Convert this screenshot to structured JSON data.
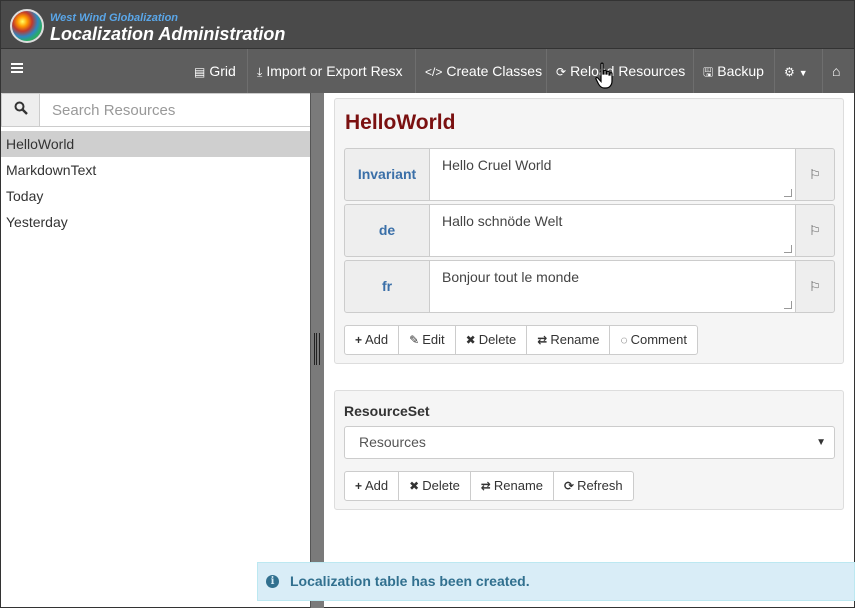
{
  "header": {
    "subtitle": "West Wind Globalization",
    "title": "Localization Administration"
  },
  "toolbar": {
    "items": [
      {
        "label": "Grid",
        "icon": "grid-icon"
      },
      {
        "label": "Import or Export Resx",
        "icon": "download-icon"
      },
      {
        "label": "Create Classes",
        "icon": "code-icon"
      },
      {
        "label": "Reload Resources",
        "icon": "refresh-icon"
      },
      {
        "label": "Backup",
        "icon": "save-icon"
      }
    ]
  },
  "search": {
    "placeholder": "Search Resources"
  },
  "resources": [
    {
      "name": "HelloWorld",
      "selected": true
    },
    {
      "name": "MarkdownText"
    },
    {
      "name": "Today"
    },
    {
      "name": "Yesterday"
    }
  ],
  "editor": {
    "resource_id": "HelloWorld",
    "rows": [
      {
        "lang": "Invariant",
        "value": "Hello Cruel World"
      },
      {
        "lang": "de",
        "value": "Hallo schnöde Welt"
      },
      {
        "lang": "fr",
        "value": "Bonjour tout le monde"
      }
    ],
    "buttons": {
      "add": "Add",
      "edit": "Edit",
      "delete": "Delete",
      "rename": "Rename",
      "comment": "Comment"
    }
  },
  "resourceset": {
    "label": "ResourceSet",
    "selected": "Resources",
    "buttons": {
      "add": "Add",
      "delete": "Delete",
      "rename": "Rename",
      "refresh": "Refresh"
    }
  },
  "toast": {
    "message": "Localization table has been created."
  },
  "colors": {
    "header_bg": "#4a4a4a",
    "toolbar_bg": "#5e5e5e",
    "title_red": "#7a1010",
    "lang_blue": "#3a6fa8",
    "toast_bg": "#d9edf7"
  }
}
